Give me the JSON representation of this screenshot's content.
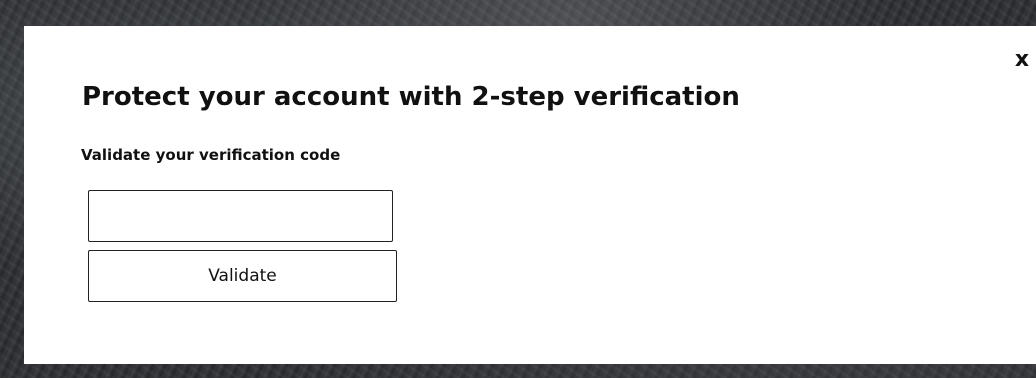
{
  "modal": {
    "close_label": "x",
    "title": "Protect your account with 2-step verification",
    "subtitle": "Validate your verification code",
    "code_input": {
      "value": "",
      "placeholder": ""
    },
    "validate_label": "Validate"
  },
  "colors": {
    "modal_background": "#ffffff",
    "text": "#111111",
    "border": "#222222",
    "backdrop": "#2b2d30"
  }
}
